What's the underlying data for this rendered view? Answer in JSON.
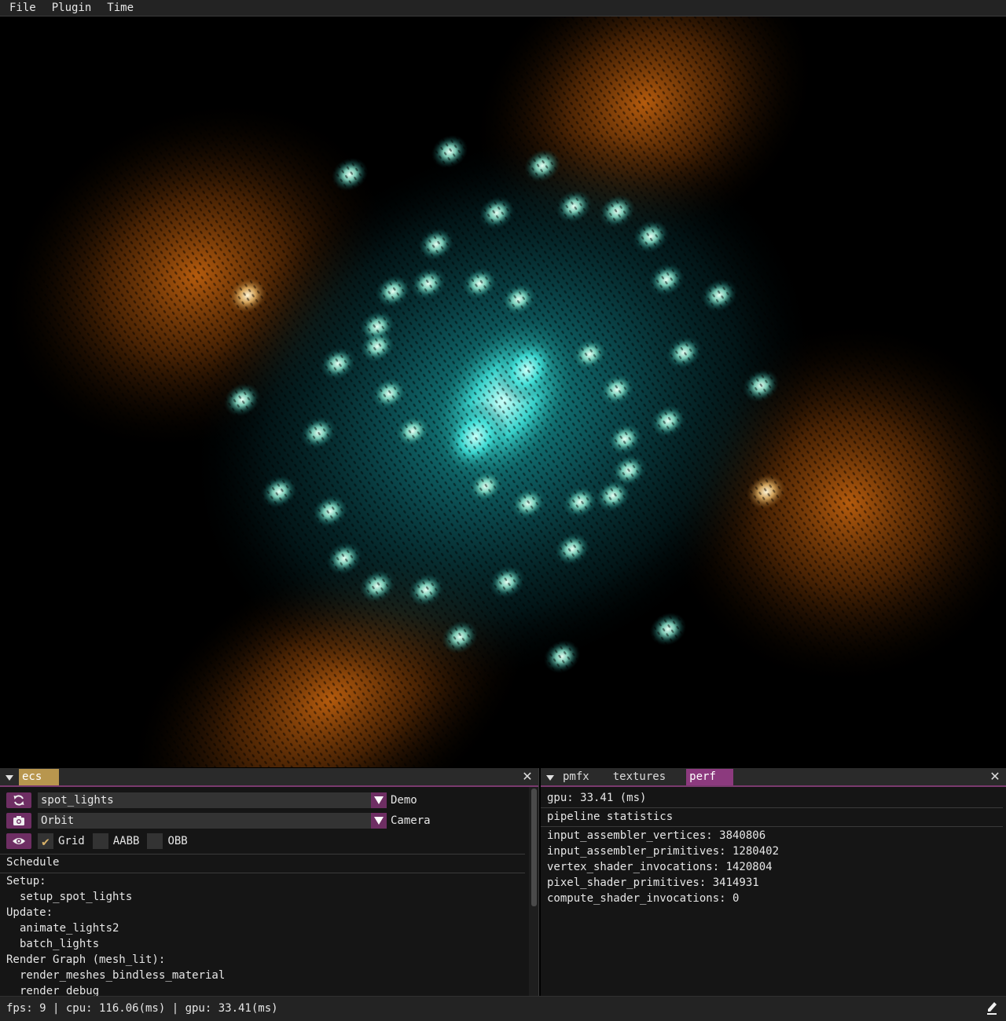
{
  "menu": [
    "File",
    "Plugin",
    "Time"
  ],
  "left_panel": {
    "tab": "ecs",
    "demo_value": "spot_lights",
    "demo_label": "Demo",
    "camera_value": "Orbit",
    "camera_label": "Camera",
    "checkboxes": [
      {
        "label": "Grid",
        "checked": true
      },
      {
        "label": "AABB",
        "checked": false
      },
      {
        "label": "OBB",
        "checked": false
      }
    ],
    "schedule_header": "Schedule",
    "schedule": [
      {
        "text": "Setup:",
        "indent": false
      },
      {
        "text": "setup_spot_lights",
        "indent": true
      },
      {
        "text": "Update:",
        "indent": false
      },
      {
        "text": "animate_lights2",
        "indent": true
      },
      {
        "text": "batch_lights",
        "indent": true
      },
      {
        "text": "Render Graph (mesh_lit):",
        "indent": false
      },
      {
        "text": "render_meshes_bindless_material",
        "indent": true
      },
      {
        "text": "render_debug",
        "indent": true
      }
    ]
  },
  "right_panel": {
    "tabs": [
      "pmfx",
      "textures",
      "perf"
    ],
    "active_tab": "perf",
    "gpu": "gpu: 33.41 (ms)",
    "pipeline_header": "pipeline statistics",
    "stats": [
      "input_assembler_vertices: 3840806",
      "input_assembler_primitives: 1280402",
      "vertex_shader_invocations: 1420804",
      "pixel_shader_primitives: 3414931",
      "compute_shader_invocations: 0"
    ]
  },
  "status": "fps: 9 | cpu: 116.06(ms) | gpu: 33.41(ms)",
  "colors": {
    "accent_gold": "#b8964e",
    "accent_pink": "#8c3a7e",
    "button_purple": "#6e2e63",
    "light_cyan": "#3ee6e0",
    "light_orange": "#d4700f"
  },
  "icons": {
    "refresh": "refresh-icon",
    "camera": "camera-icon",
    "eye": "eye-icon",
    "pen": "pen-icon"
  }
}
